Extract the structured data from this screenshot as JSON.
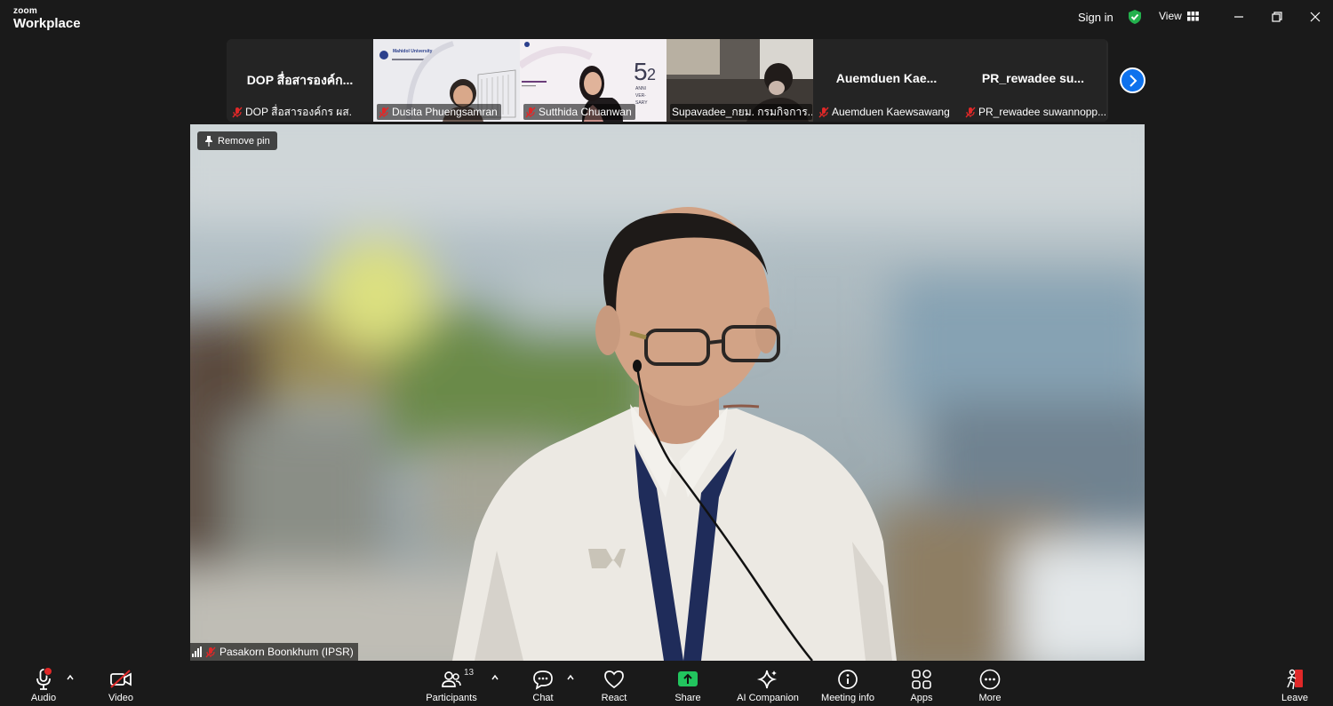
{
  "app": {
    "brand_small": "zoom",
    "brand_big": "Workplace"
  },
  "titlebar": {
    "signin": "Sign in",
    "view": "View"
  },
  "thumbnails": [
    {
      "big": "DOP สื่อสารองค์ก...",
      "label": "DOP สื่อสารองค์กร ผส.",
      "muted": true,
      "video": false
    },
    {
      "big": "",
      "label": "Dusita Phuengsamran",
      "muted": true,
      "video": true
    },
    {
      "big": "",
      "label": "Sutthida Chuanwan",
      "muted": true,
      "video": true
    },
    {
      "big": "",
      "label": "Supavadee_กยม. กรมกิจการ...",
      "muted": false,
      "video": true
    },
    {
      "big": "Auemduen  Kae...",
      "label": "Auemduen Kaewsawang",
      "muted": true,
      "video": false
    },
    {
      "big": "PR_rewadee  su...",
      "label": "PR_rewadee suwannopp...",
      "muted": true,
      "video": false
    }
  ],
  "thumb_text": {
    "uni": "Mahidol University",
    "anniv": [
      "ANNI",
      "VER-",
      "SARY"
    ]
  },
  "main": {
    "remove_pin": "Remove pin",
    "speaker": "Pasakorn Boonkhum (IPSR)"
  },
  "toolbar": {
    "audio": "Audio",
    "video": "Video",
    "participants": "Participants",
    "participants_count": "13",
    "chat": "Chat",
    "react": "React",
    "share": "Share",
    "ai": "AI Companion",
    "meeting_info": "Meeting info",
    "apps": "Apps",
    "more": "More",
    "leave": "Leave"
  },
  "colors": {
    "accent": "#0e72ed",
    "share": "#22c55e",
    "leave": "#e02828",
    "shield": "#23b14d"
  }
}
